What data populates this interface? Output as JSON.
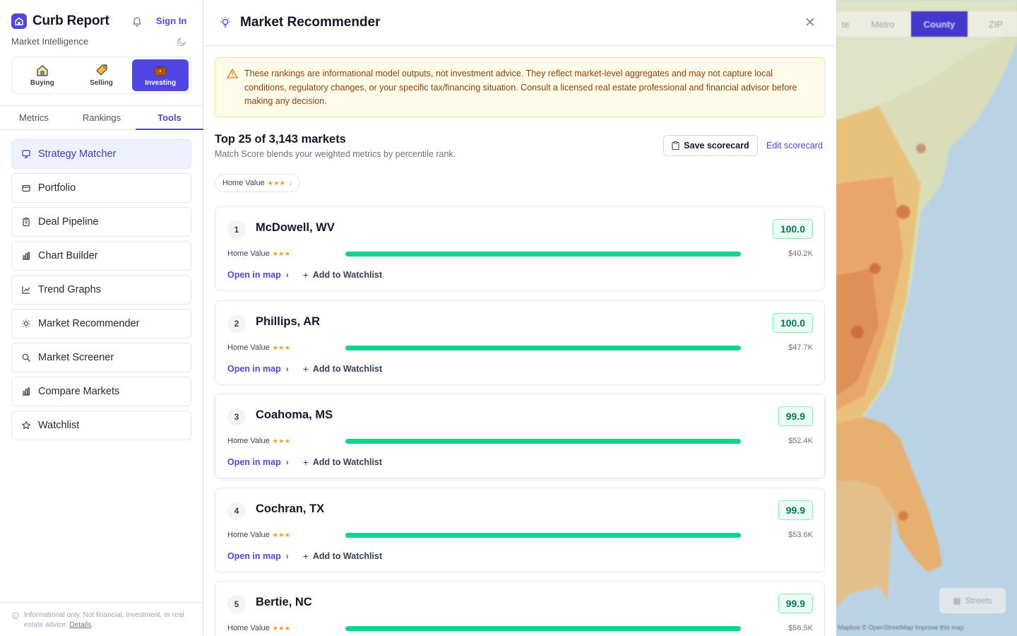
{
  "app": {
    "title": "Curb Report",
    "subtitle": "Market Intelligence",
    "sign_in": "Sign In"
  },
  "modes": [
    {
      "label": "Buying",
      "icon": "house-icon"
    },
    {
      "label": "Selling",
      "icon": "tag-icon"
    },
    {
      "label": "Investing",
      "icon": "briefcase-icon",
      "active": true
    }
  ],
  "tabs": [
    {
      "label": "Metrics"
    },
    {
      "label": "Rankings"
    },
    {
      "label": "Tools",
      "active": true
    }
  ],
  "tools": [
    {
      "label": "Strategy Matcher",
      "icon": "monitor-icon",
      "active": true
    },
    {
      "label": "Portfolio",
      "icon": "wallet-icon"
    },
    {
      "label": "Deal Pipeline",
      "icon": "clipboard-icon"
    },
    {
      "label": "Chart Builder",
      "icon": "bar-chart-icon"
    },
    {
      "label": "Trend Graphs",
      "icon": "line-chart-icon"
    },
    {
      "label": "Market Recommender",
      "icon": "lightbulb-icon"
    },
    {
      "label": "Market Screener",
      "icon": "search-icon"
    },
    {
      "label": "Compare Markets",
      "icon": "bar-chart-icon"
    },
    {
      "label": "Watchlist",
      "icon": "star-icon"
    }
  ],
  "sidebar_footer": {
    "text": "Informational only. Not financial, investment, or real estate advice.",
    "link": "Details"
  },
  "panel": {
    "title": "Market Recommender",
    "warning": "These rankings are informational model outputs, not investment advice. They reflect market-level aggregates and may not capture local conditions, regulatory changes, or your specific tax/financing situation. Consult a licensed real estate professional and financial advisor before making any decision.",
    "summary_title": "Top 25 of 3,143 markets",
    "summary_sub": "Match Score blends your weighted metrics by percentile rank.",
    "save_button": "Save scorecard",
    "edit_link": "Edit scorecard",
    "filter_chip": "Home Value",
    "stars": "★★★",
    "open_map": "Open in map",
    "add_watchlist": "Add to Watchlist"
  },
  "results": [
    {
      "rank": "1",
      "name": "McDowell, WV",
      "score": "100.0",
      "metric": "Home Value",
      "value": "$40.2K",
      "fill": 1.0
    },
    {
      "rank": "2",
      "name": "Phillips, AR",
      "score": "100.0",
      "metric": "Home Value",
      "value": "$47.7K",
      "fill": 1.0
    },
    {
      "rank": "3",
      "name": "Coahoma, MS",
      "score": "99.9",
      "metric": "Home Value",
      "value": "$52.4K",
      "fill": 1.0
    },
    {
      "rank": "4",
      "name": "Cochran, TX",
      "score": "99.9",
      "metric": "Home Value",
      "value": "$53.6K",
      "fill": 1.0
    },
    {
      "rank": "5",
      "name": "Bertie, NC",
      "score": "99.9",
      "metric": "Home Value",
      "value": "$56.5K",
      "fill": 1.0
    }
  ],
  "map": {
    "toggle": [
      "te",
      "Metro",
      "County",
      "ZIP"
    ],
    "active_toggle": "County",
    "streets": "Streets",
    "attribution": "Mapbox © OpenStreetMap Improve this map"
  },
  "colors": {
    "accent": "#4f46e5",
    "score_green": "#047857",
    "bar_green": "#10d48e",
    "warning_bg": "#fefce8"
  }
}
